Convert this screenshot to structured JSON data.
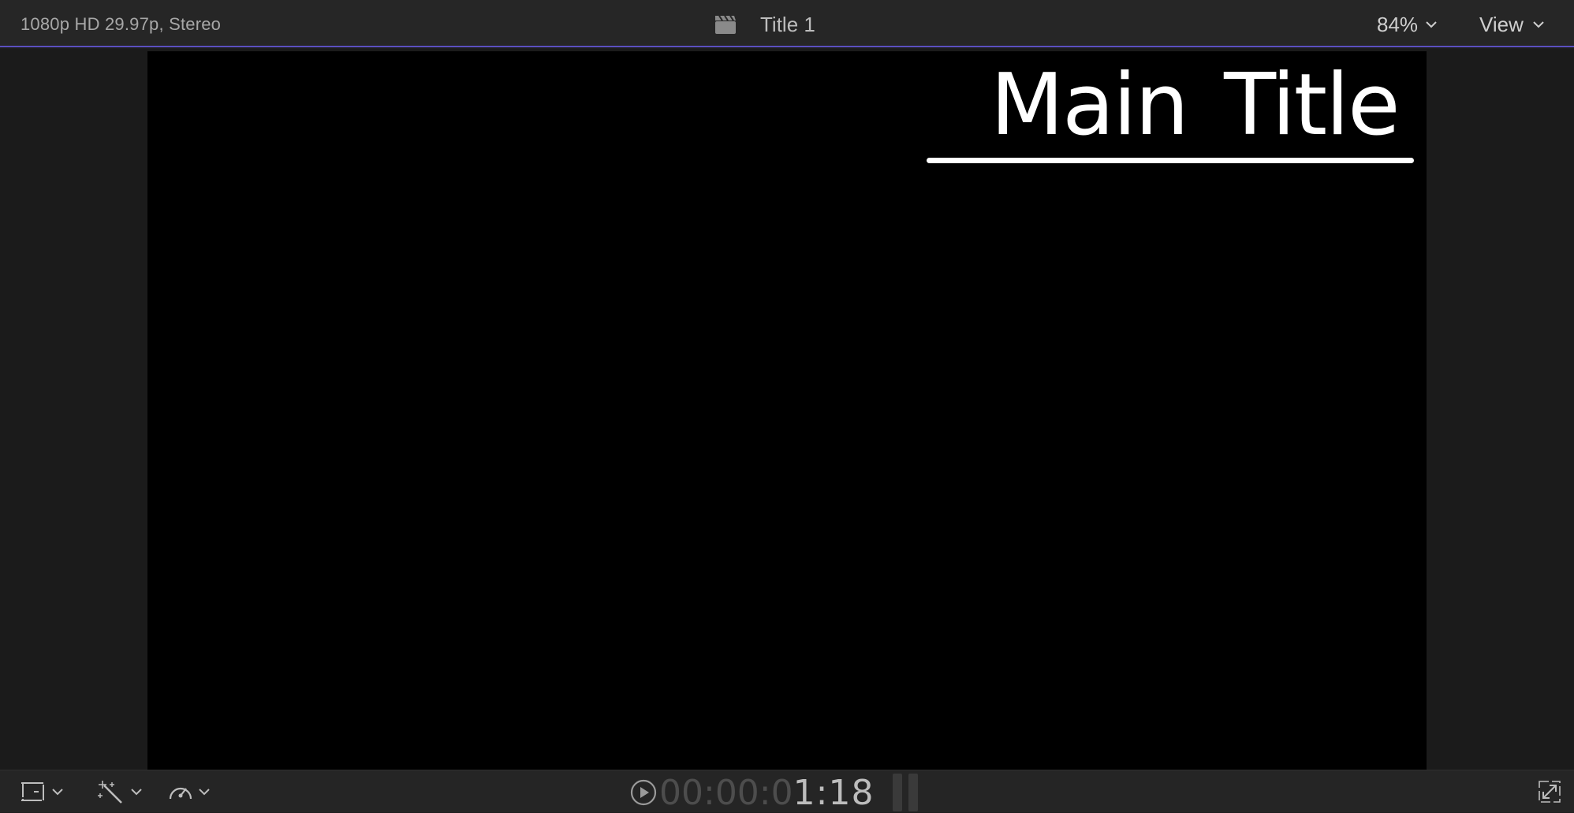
{
  "header": {
    "format_info": "1080p HD 29.97p, Stereo",
    "title": "Title 1",
    "zoom_label": "84%",
    "view_label": "View"
  },
  "canvas": {
    "title_text": "Main Title"
  },
  "footer": {
    "timecode_dim": "00:00:0",
    "timecode_bright": "1:18"
  },
  "icons": {
    "clapper": "clapperboard-icon",
    "transform": "transform-crop-icon",
    "enhance": "magic-wand-icon",
    "retime": "speedometer-icon",
    "play": "play-circle-icon",
    "fullscreen": "fullscreen-icon"
  },
  "colors": {
    "accent_line": "#5b4fc0",
    "canvas_bg": "#000000",
    "title_color": "#ffffff"
  }
}
